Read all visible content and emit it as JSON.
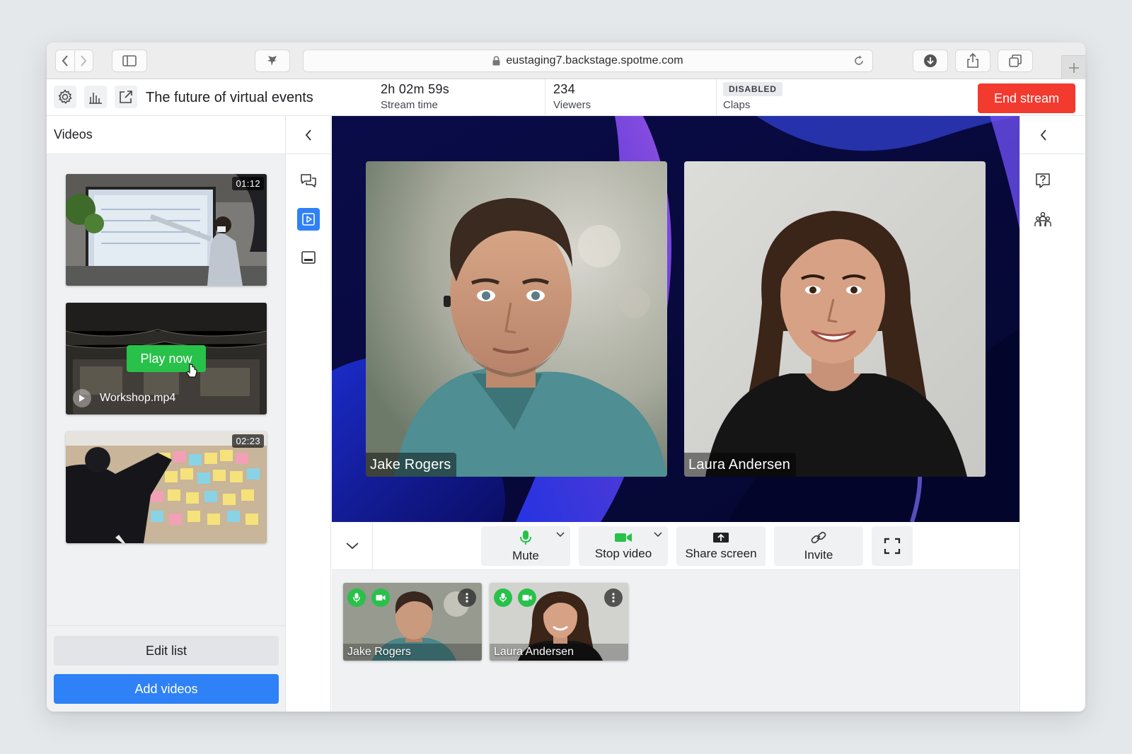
{
  "browser": {
    "url": "eustaging7.backstage.spotme.com"
  },
  "header": {
    "title": "The future of virtual events",
    "stream_time": {
      "value": "2h 02m 59s",
      "label": "Stream time"
    },
    "viewers": {
      "value": "234",
      "label": "Viewers"
    },
    "claps": {
      "badge": "DISABLED",
      "label": "Claps"
    },
    "end_stream_label": "End stream"
  },
  "videos_panel": {
    "title": "Videos",
    "items": [
      {
        "duration": "01:12"
      },
      {
        "play_label": "Play now",
        "filename": "Workshop.mp4"
      },
      {
        "duration": "02:23"
      }
    ],
    "edit_label": "Edit list",
    "add_label": "Add videos"
  },
  "stage": {
    "participants": [
      {
        "name": "Jake Rogers"
      },
      {
        "name": "Laura Andersen"
      }
    ]
  },
  "controls": {
    "mute_label": "Mute",
    "stop_video_label": "Stop video",
    "share_screen_label": "Share screen",
    "invite_label": "Invite"
  },
  "strip": {
    "participants": [
      {
        "name": "Jake Rogers"
      },
      {
        "name": "Laura Andersen"
      }
    ]
  },
  "colors": {
    "accent_blue": "#2e81f6",
    "end_stream_red": "#f23a2f",
    "live_green": "#28c14a",
    "stage_bg": "#0b0d4f"
  },
  "icons": [
    "back-icon",
    "forward-icon",
    "sidebar-icon",
    "extension-icon",
    "lock-icon",
    "reload-icon",
    "download-icon",
    "share-icon",
    "tabs-icon",
    "settings-icon",
    "analytics-icon",
    "external-link-icon",
    "chat-icon",
    "video-library-icon",
    "lower-third-icon",
    "question-icon",
    "people-icon",
    "microphone-icon",
    "camera-icon",
    "share-screen-icon",
    "link-icon",
    "fullscreen-icon"
  ]
}
